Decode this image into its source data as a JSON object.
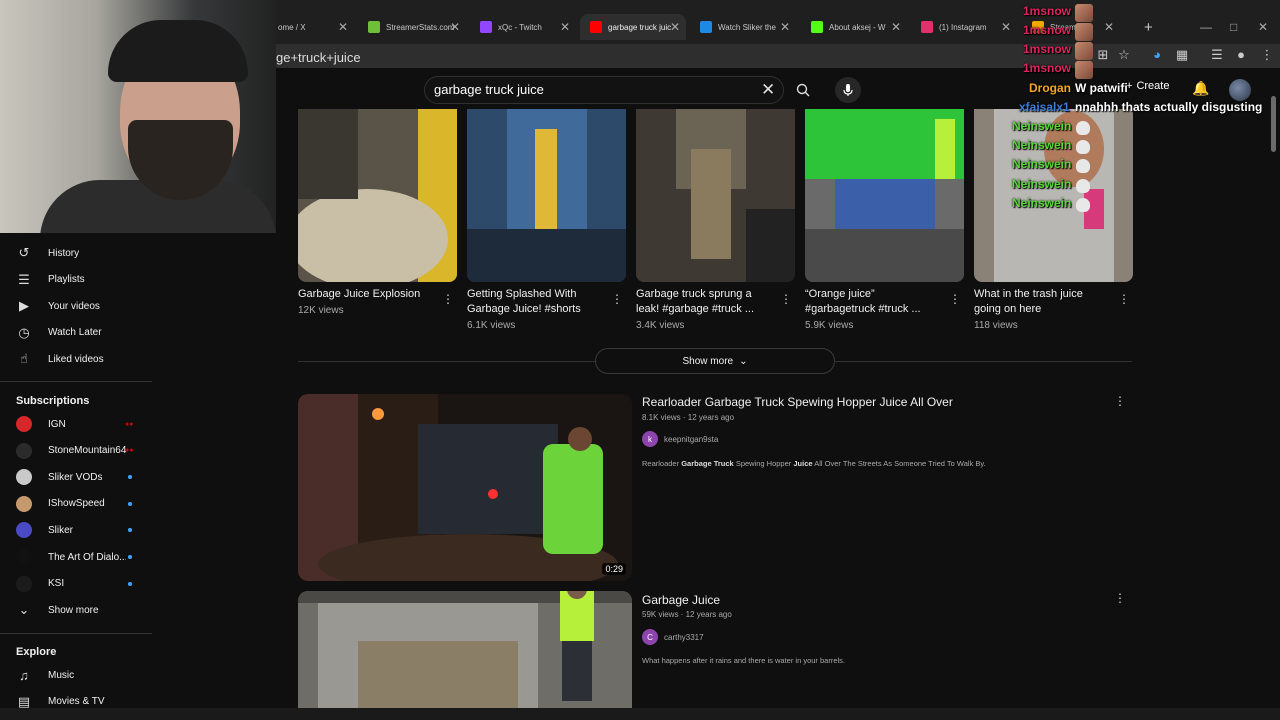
{
  "browser": {
    "tabs": [
      {
        "label": "ome / X",
        "favicon_color": "#000000"
      },
      {
        "label": "StreamerStats.com",
        "favicon_color": "#6fbf3b"
      },
      {
        "label": "xQc - Twitch",
        "favicon_color": "#9146ff"
      },
      {
        "label": "garbage truck juic",
        "favicon_color": "#ff0000"
      },
      {
        "label": "Watch Sliker the",
        "favicon_color": "#1e88e5"
      },
      {
        "label": "About aksej - W",
        "favicon_color": "#53fc18"
      },
      {
        "label": "(1) Instagram",
        "favicon_color": "#e1306c"
      },
      {
        "label": "Stream",
        "favicon_color": "#f2a900"
      }
    ],
    "new_tab": "+",
    "url": "ge+truck+juice"
  },
  "youtube": {
    "search_value": "garbage truck juice",
    "create_label": "Create"
  },
  "sidebar": {
    "you_items": [
      {
        "label": "History",
        "icon": "history-icon"
      },
      {
        "label": "Playlists",
        "icon": "playlist-icon"
      },
      {
        "label": "Your videos",
        "icon": "video-icon"
      },
      {
        "label": "Watch Later",
        "icon": "clock-icon"
      },
      {
        "label": "Liked videos",
        "icon": "thumbs-up-icon"
      }
    ],
    "subscriptions_heading": "Subscriptions",
    "subscriptions": [
      {
        "label": "IGN",
        "avatar_color": "#d62828",
        "status": "live"
      },
      {
        "label": "StoneMountain64",
        "avatar_color": "#2b2b2b",
        "status": "live"
      },
      {
        "label": "Sliker VODs",
        "avatar_color": "#c9c9c9",
        "status": "dot"
      },
      {
        "label": "IShowSpeed",
        "avatar_color": "#c49a6c",
        "status": "dot"
      },
      {
        "label": "Sliker",
        "avatar_color": "#4a4ac4",
        "status": "dot"
      },
      {
        "label": "The Art Of Dialo...",
        "avatar_color": "#111111",
        "status": "dot"
      },
      {
        "label": "KSI",
        "avatar_color": "#1b1b1b",
        "status": "dot"
      }
    ],
    "show_more": "Show more",
    "explore_heading": "Explore",
    "explore": [
      {
        "label": "Music",
        "icon": "music-note-icon"
      },
      {
        "label": "Movies & TV",
        "icon": "film-icon"
      }
    ]
  },
  "shorts": [
    {
      "title": "Garbage Juice Explosion",
      "views": "12K views"
    },
    {
      "title": "Getting Splashed With Garbage Juice! #shorts",
      "views": "6.1K views"
    },
    {
      "title": "Garbage truck sprung a leak! #garbage #truck ...",
      "views": "3.4K views"
    },
    {
      "title": "“Orange juice” #garbagetruck #truck ...",
      "views": "5.9K views"
    },
    {
      "title": "What in the trash juice going on here",
      "views": "118 views"
    }
  ],
  "show_more_button": "Show more",
  "videos": [
    {
      "title": "Rearloader Garbage Truck Spewing Hopper Juice All Over",
      "meta": "8.1K views · 12 years ago",
      "channel": "keepnitgan9sta",
      "channel_initial": "k",
      "duration": "0:29",
      "desc_parts": [
        "Rearloader ",
        "Garbage Truck",
        " Spewing Hopper ",
        "Juice",
        " All Over The Streets As Someone Tried To Walk By."
      ]
    },
    {
      "title": "Garbage Juice",
      "meta": "59K views · 12 years ago",
      "channel": "carthy3317",
      "channel_initial": "C",
      "description": "What happens after it rains and there is water in your barrels."
    }
  ],
  "chat": [
    {
      "user": "1msnow",
      "message": "",
      "color": "#e0245e"
    },
    {
      "user": "1msnow",
      "message": "",
      "color": "#e0245e"
    },
    {
      "user": "1msnow",
      "message": "",
      "color": "#e0245e"
    },
    {
      "user": "1msnow",
      "message": "",
      "color": "#e0245e"
    },
    {
      "user": "Drogan",
      "message": "W patwifi",
      "color": "#f5a623"
    },
    {
      "user": "xfaisalx1",
      "message": "nnahhh thats actually disgusting",
      "color": "#3b7dd8"
    },
    {
      "user": "Neinswein",
      "message": "",
      "color": "#59d43b"
    },
    {
      "user": "Neinswein",
      "message": "",
      "color": "#59d43b"
    },
    {
      "user": "Neinswein",
      "message": "",
      "color": "#59d43b"
    },
    {
      "user": "Neinswein",
      "message": "",
      "color": "#59d43b"
    },
    {
      "user": "Neinswein",
      "message": "",
      "color": "#59d43b"
    }
  ]
}
